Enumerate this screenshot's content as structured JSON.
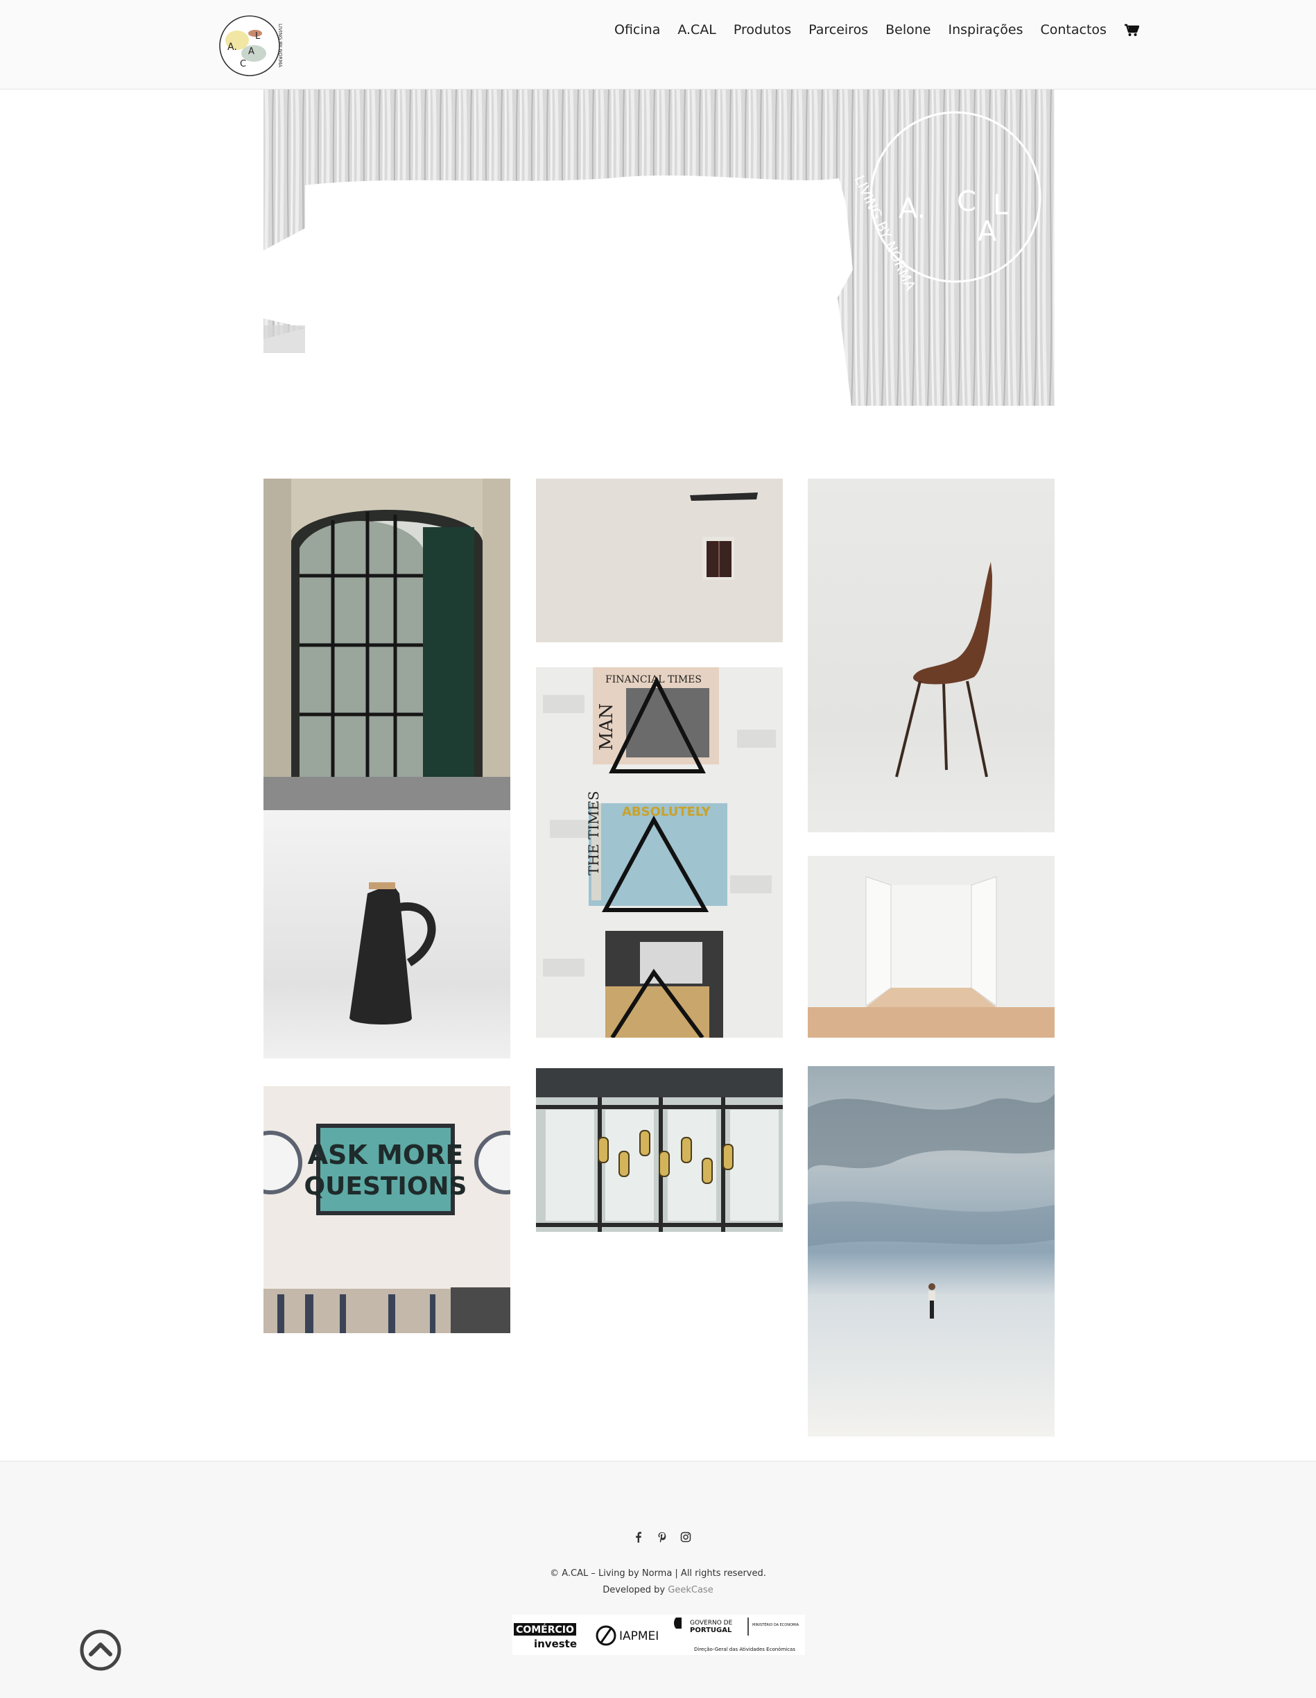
{
  "header": {
    "logo_letters": [
      "A.",
      "L",
      "A",
      "C"
    ],
    "logo_tagline": "LIVING BY NORMA",
    "nav": [
      "Oficina",
      "A.CAL",
      "Produtos",
      "Parceiros",
      "Belone",
      "Inspirações",
      "Contactos"
    ]
  },
  "hero": {
    "emblem_letters": [
      "A.",
      "C",
      "L",
      "A"
    ],
    "emblem_tagline": "LIVING BY NORMA"
  },
  "gallery": {
    "poster_line1": "ASK MORE",
    "poster_line2": "QUESTIONS",
    "magazine_1": "FINANCIAL TIMES",
    "magazine_2": "MAN",
    "magazine_3": "ABSOLUTELY",
    "magazine_4": "THE TIMES"
  },
  "footer": {
    "social": [
      "facebook-icon",
      "pinterest-icon",
      "instagram-icon"
    ],
    "copyright": "© A.CAL – Living by Norma | All rights reserved.",
    "developed_prefix": "Developed by",
    "developer": "GeekCase",
    "sponsors": {
      "comercio_1": "COMÉRCIO",
      "comercio_2": "investe",
      "iapmei": "IAPMEI",
      "gov_1": "GOVERNO DE",
      "gov_2": "PORTUGAL",
      "ministry": "MINISTÉRIO DA ECONOMIA",
      "direcao": "Direção-Geral das Atividades Económicas"
    }
  }
}
